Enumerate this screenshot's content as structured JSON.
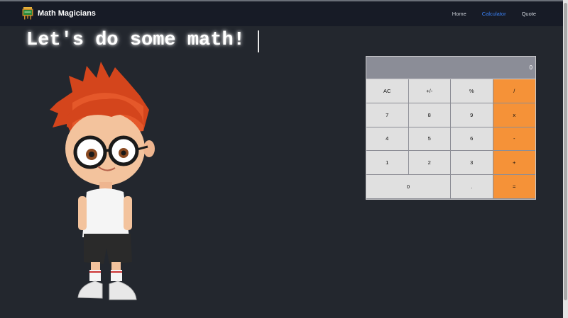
{
  "brand": {
    "title": "Math Magicians",
    "icon": "chalkboard-icon"
  },
  "nav": {
    "links": [
      "Home",
      "Calculator",
      "Quote"
    ],
    "active": "Calculator",
    "active_color": "#3b82f6"
  },
  "heading": "Let's do some math!",
  "calculator": {
    "display": "0",
    "keys": [
      "AC",
      "+/-",
      "%",
      "/",
      "7",
      "8",
      "9",
      "x",
      "4",
      "5",
      "6",
      "-",
      "1",
      "2",
      "3",
      "+",
      "0",
      ".",
      "="
    ],
    "operator_color": "#f59238",
    "key_color": "#e0e0e0"
  },
  "colors": {
    "background": "#23272e",
    "navbar": "#171b26"
  }
}
